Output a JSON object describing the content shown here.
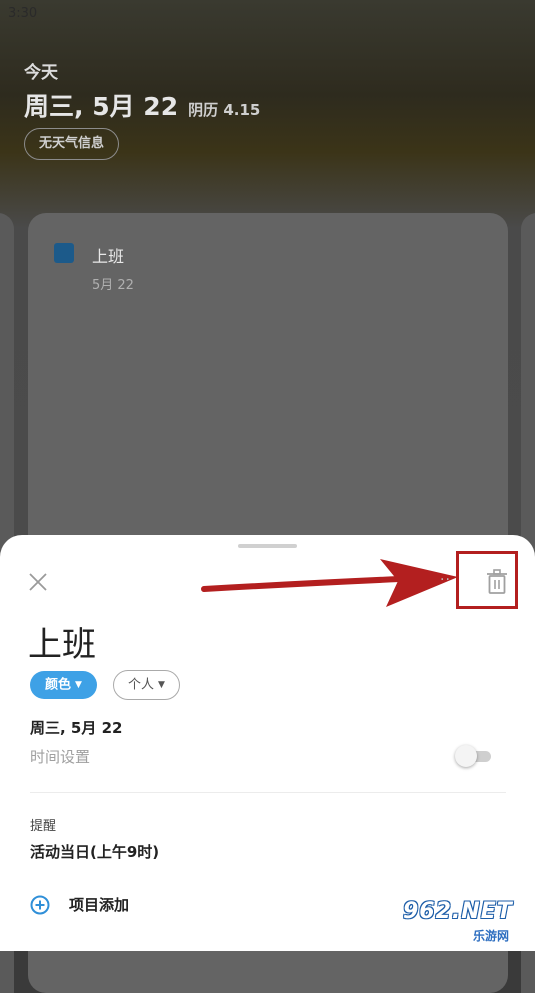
{
  "status_bar": {
    "time": "3:30"
  },
  "header": {
    "today_label": "今天",
    "date": "周三, 5月 22",
    "lunar": "阴历 4.15",
    "weather_button": "无天气信息"
  },
  "background_card": {
    "event_title": "上班",
    "event_date": "5月 22"
  },
  "sheet": {
    "title": "上班",
    "more_label": "··",
    "color_chip": "颜色",
    "category_chip": "个人",
    "date": "周三, 5月 22",
    "time_setting_label": "时间设置",
    "time_toggle_on": false,
    "reminder_label": "提醒",
    "reminder_value": "活动当日(上午9时)",
    "add_item_label": "项目添加"
  },
  "watermark": {
    "top": "962.NET",
    "bottom": "乐游网"
  },
  "colors": {
    "accent": "#3ea1e6",
    "annotation": "#b31f1f"
  },
  "icons": [
    "close-icon",
    "more-icon",
    "trash-icon",
    "add-circle-icon",
    "chevron-down-icon"
  ]
}
